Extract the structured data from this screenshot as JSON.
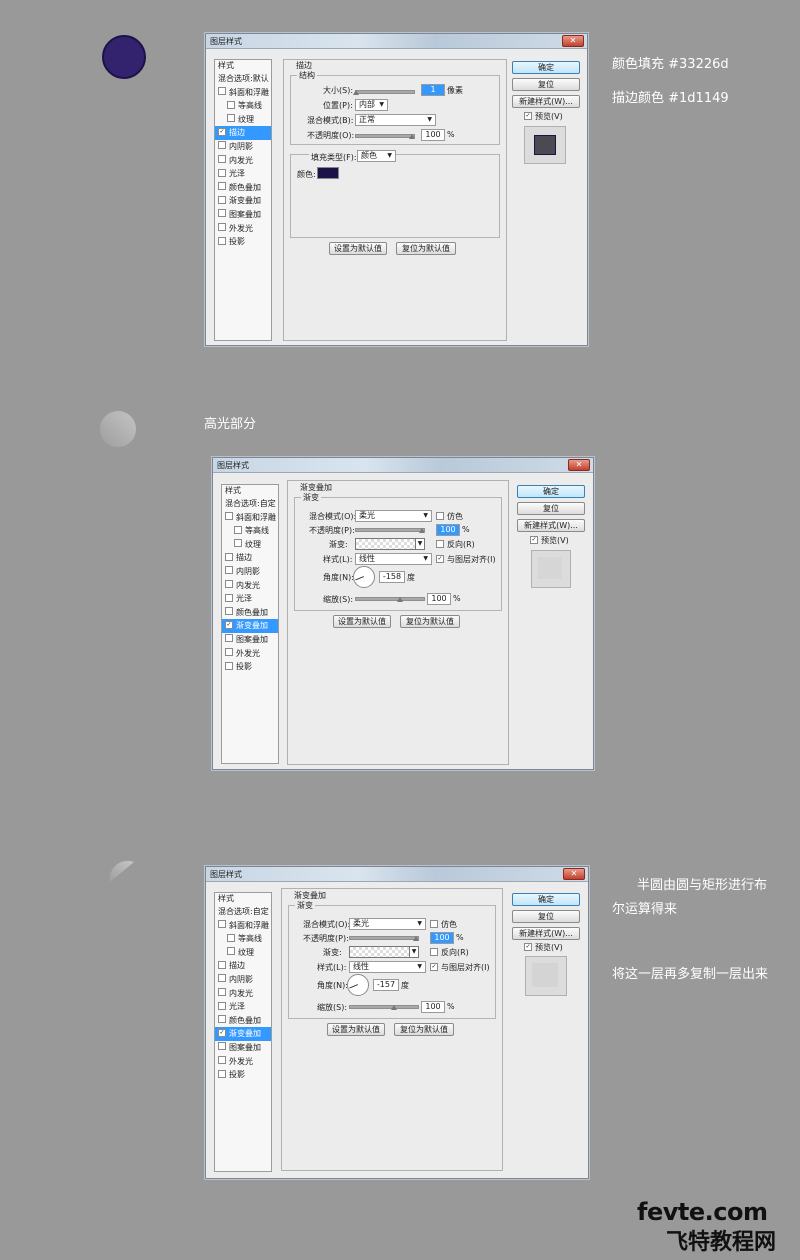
{
  "notes": {
    "fill_color": "颜色填充 #33226d",
    "stroke_color": "描边颜色 #1d1149",
    "highlight": "高光部分",
    "boolean_line1": "半圆由圆与矩形进行布",
    "boolean_line2": "尔运算得来",
    "duplicate": "将这一层再多复制一层出来"
  },
  "colors": {
    "circle_fill": "#33226d",
    "circle_stroke": "#1d1149",
    "page_bg": "#999999",
    "selection": "#3399ff"
  },
  "dialog1": {
    "title": "图层样式",
    "close": "✕",
    "styles_header": "样式",
    "left_items": [
      {
        "label": "混合选项:默认",
        "checked": false,
        "checkbox": false,
        "sub": false,
        "selected": false
      },
      {
        "label": "斜面和浮雕",
        "checked": false,
        "checkbox": true,
        "sub": false,
        "selected": false
      },
      {
        "label": "等高线",
        "checked": false,
        "checkbox": true,
        "sub": true,
        "selected": false
      },
      {
        "label": "纹理",
        "checked": false,
        "checkbox": true,
        "sub": true,
        "selected": false
      },
      {
        "label": "描边",
        "checked": true,
        "checkbox": true,
        "sub": false,
        "selected": true
      },
      {
        "label": "内阴影",
        "checked": false,
        "checkbox": true,
        "sub": false,
        "selected": false
      },
      {
        "label": "内发光",
        "checked": false,
        "checkbox": true,
        "sub": false,
        "selected": false
      },
      {
        "label": "光泽",
        "checked": false,
        "checkbox": true,
        "sub": false,
        "selected": false
      },
      {
        "label": "颜色叠加",
        "checked": false,
        "checkbox": true,
        "sub": false,
        "selected": false
      },
      {
        "label": "渐变叠加",
        "checked": false,
        "checkbox": true,
        "sub": false,
        "selected": false
      },
      {
        "label": "图案叠加",
        "checked": false,
        "checkbox": true,
        "sub": false,
        "selected": false
      },
      {
        "label": "外发光",
        "checked": false,
        "checkbox": true,
        "sub": false,
        "selected": false
      },
      {
        "label": "投影",
        "checked": false,
        "checkbox": true,
        "sub": false,
        "selected": false
      }
    ],
    "section_title": "描边",
    "group_title": "结构",
    "size_label": "大小(S):",
    "size_value": "1",
    "size_unit": "像素",
    "position_label": "位置(P):",
    "position_value": "内部",
    "blend_label": "混合模式(B):",
    "blend_value": "正常",
    "opacity_label": "不透明度(O):",
    "opacity_value": "100",
    "percent": "%",
    "fill_type_label": "填充类型(F):",
    "fill_type_value": "颜色",
    "color_label": "颜色:",
    "stroke_swatch": "#1d1149",
    "reset_default": "设置为默认值",
    "restore_default": "复位为默认值",
    "ok": "确定",
    "reset": "复位",
    "new_style": "新建样式(W)...",
    "preview": "预览(V)"
  },
  "dialog2": {
    "title": "图层样式",
    "close": "✕",
    "styles_header": "样式",
    "left_items": [
      {
        "label": "混合选项:自定",
        "checked": false,
        "checkbox": false,
        "sub": false,
        "selected": false
      },
      {
        "label": "斜面和浮雕",
        "checked": false,
        "checkbox": true,
        "sub": false,
        "selected": false
      },
      {
        "label": "等高线",
        "checked": false,
        "checkbox": true,
        "sub": true,
        "selected": false
      },
      {
        "label": "纹理",
        "checked": false,
        "checkbox": true,
        "sub": true,
        "selected": false
      },
      {
        "label": "描边",
        "checked": false,
        "checkbox": true,
        "sub": false,
        "selected": false
      },
      {
        "label": "内阴影",
        "checked": false,
        "checkbox": true,
        "sub": false,
        "selected": false
      },
      {
        "label": "内发光",
        "checked": false,
        "checkbox": true,
        "sub": false,
        "selected": false
      },
      {
        "label": "光泽",
        "checked": false,
        "checkbox": true,
        "sub": false,
        "selected": false
      },
      {
        "label": "颜色叠加",
        "checked": false,
        "checkbox": true,
        "sub": false,
        "selected": false
      },
      {
        "label": "渐变叠加",
        "checked": true,
        "checkbox": true,
        "sub": false,
        "selected": true
      },
      {
        "label": "图案叠加",
        "checked": false,
        "checkbox": true,
        "sub": false,
        "selected": false
      },
      {
        "label": "外发光",
        "checked": false,
        "checkbox": true,
        "sub": false,
        "selected": false
      },
      {
        "label": "投影",
        "checked": false,
        "checkbox": true,
        "sub": false,
        "selected": false
      }
    ],
    "section_title": "渐变叠加",
    "group_title": "渐变",
    "blend_label": "混合模式(O):",
    "blend_value": "柔光",
    "dither_label": "仿色",
    "opacity_label": "不透明度(P):",
    "opacity_value": "100",
    "percent": "%",
    "gradient_label": "渐变:",
    "reverse_label": "反向(R)",
    "style_label": "样式(L):",
    "style_value": "线性",
    "align_label": "与图层对齐(I)",
    "angle_label": "角度(N):",
    "angle_value": "-158",
    "degree": "度",
    "scale_label": "缩放(S):",
    "scale_value": "100",
    "reset_default": "设置为默认值",
    "restore_default": "复位为默认值",
    "ok": "确定",
    "reset": "复位",
    "new_style": "新建样式(W)...",
    "preview": "预览(V)"
  },
  "dialog3": {
    "title": "图层样式",
    "close": "✕",
    "styles_header": "样式",
    "left_items": [
      {
        "label": "混合选项:自定",
        "checked": false,
        "checkbox": false,
        "sub": false,
        "selected": false
      },
      {
        "label": "斜面和浮雕",
        "checked": false,
        "checkbox": true,
        "sub": false,
        "selected": false
      },
      {
        "label": "等高线",
        "checked": false,
        "checkbox": true,
        "sub": true,
        "selected": false
      },
      {
        "label": "纹理",
        "checked": false,
        "checkbox": true,
        "sub": true,
        "selected": false
      },
      {
        "label": "描边",
        "checked": false,
        "checkbox": true,
        "sub": false,
        "selected": false
      },
      {
        "label": "内阴影",
        "checked": false,
        "checkbox": true,
        "sub": false,
        "selected": false
      },
      {
        "label": "内发光",
        "checked": false,
        "checkbox": true,
        "sub": false,
        "selected": false
      },
      {
        "label": "光泽",
        "checked": false,
        "checkbox": true,
        "sub": false,
        "selected": false
      },
      {
        "label": "颜色叠加",
        "checked": false,
        "checkbox": true,
        "sub": false,
        "selected": false
      },
      {
        "label": "渐变叠加",
        "checked": true,
        "checkbox": true,
        "sub": false,
        "selected": true
      },
      {
        "label": "图案叠加",
        "checked": false,
        "checkbox": true,
        "sub": false,
        "selected": false
      },
      {
        "label": "外发光",
        "checked": false,
        "checkbox": true,
        "sub": false,
        "selected": false
      },
      {
        "label": "投影",
        "checked": false,
        "checkbox": true,
        "sub": false,
        "selected": false
      }
    ],
    "section_title": "渐变叠加",
    "group_title": "渐变",
    "blend_label": "混合模式(O):",
    "blend_value": "柔光",
    "dither_label": "仿色",
    "opacity_label": "不透明度(P):",
    "opacity_value": "100",
    "percent": "%",
    "gradient_label": "渐变:",
    "reverse_label": "反向(R)",
    "style_label": "样式(L):",
    "style_value": "线性",
    "align_label": "与图层对齐(I)",
    "angle_label": "角度(N):",
    "angle_value": "-157",
    "degree": "度",
    "scale_label": "缩放(S):",
    "scale_value": "100",
    "reset_default": "设置为默认值",
    "restore_default": "复位为默认值",
    "ok": "确定",
    "reset": "复位",
    "new_style": "新建样式(W)...",
    "preview": "预览(V)"
  },
  "logo": {
    "line1": "fevte.com",
    "line2": "飞特教程网"
  }
}
